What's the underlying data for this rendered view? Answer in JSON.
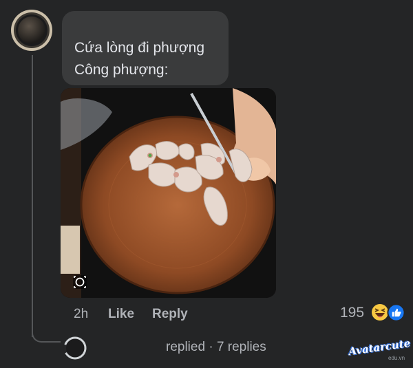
{
  "comment": {
    "text_line_1": "Cứa lòng đi phượng",
    "text_line_2": "Công phượng:",
    "time": "2h",
    "like_label": "Like",
    "reply_label": "Reply",
    "reaction_count": "195",
    "reactions": [
      "haha-icon",
      "like-icon"
    ]
  },
  "replies_row": {
    "verb": "replied",
    "separator": "·",
    "count_label": "7 replies"
  },
  "watermark": {
    "brand": "Avatarcute",
    "domain": "edu.vn"
  },
  "colors": {
    "background": "#242526",
    "bubble": "#3a3b3c",
    "text_primary": "#e4e6eb",
    "text_secondary": "#b0b3b8",
    "like_blue": "#1877f2",
    "haha_yellow": "#f7c843"
  }
}
